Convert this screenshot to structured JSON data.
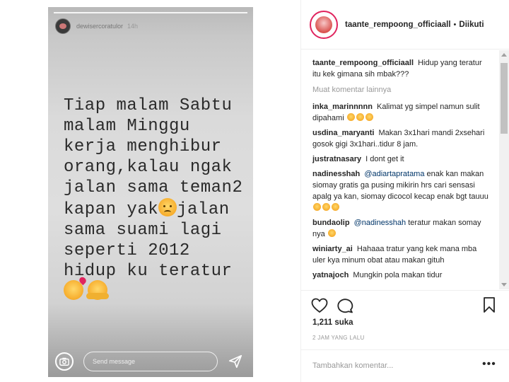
{
  "story": {
    "username": "dewisercoratulor",
    "time": "14h",
    "text": "Tiap malam Sabtu\nmalam Minggu\nkerja menghibur\norang,kalau ngak\njalan sama teman2\nkapan yak",
    "text_after_emoji": "jalan\nsama suami lagi\nseperti 2012\nhidup ku teratur",
    "send_placeholder": "Send message"
  },
  "post": {
    "owner": "taante_rempoong_officiaall",
    "separator": "•",
    "follow_label": "Diikuti",
    "caption": {
      "user": "taante_rempoong_officiaall",
      "text": "Hidup yang teratur itu kek gimana sih mbak???"
    },
    "load_more": "Muat komentar lainnya",
    "comments": [
      {
        "user": "inka_marinnnnn",
        "text": "Kalimat yg simpel namun sulit dipahami"
      },
      {
        "user": "usdina_maryanti",
        "text": "Makan 3x1hari mandi 2xsehari gosok gigi 3x1hari..tidur 8 jam."
      },
      {
        "user": "justratnasary",
        "text": "I dont get it"
      },
      {
        "user": "nadinesshah",
        "mention": "@adiartapratama",
        "text": "enak kan makan siomay gratis ga pusing mikirin hrs cari sensasi apalg ya kan, siomay dicocol kecap enak bgt tauuu"
      },
      {
        "user": "bundaolip",
        "mention": "@nadinesshah",
        "text": "teratur makan somay nya"
      },
      {
        "user": "winiarty_ai",
        "text": "Hahaaa tratur yang kek mana mba uler kya minum obat atau makan gituh"
      },
      {
        "user": "yatnajoch",
        "text": "Mungkin pola makan tidur"
      }
    ],
    "likes": "1,211 suka",
    "time_ago": "2 JAM YANG LALU",
    "add_comment_placeholder": "Tambahkan komentar...",
    "more": "•••"
  },
  "colors": {
    "accent_red": "#e0245e",
    "text": "#262626",
    "muted": "#999999",
    "mention": "#003569"
  }
}
